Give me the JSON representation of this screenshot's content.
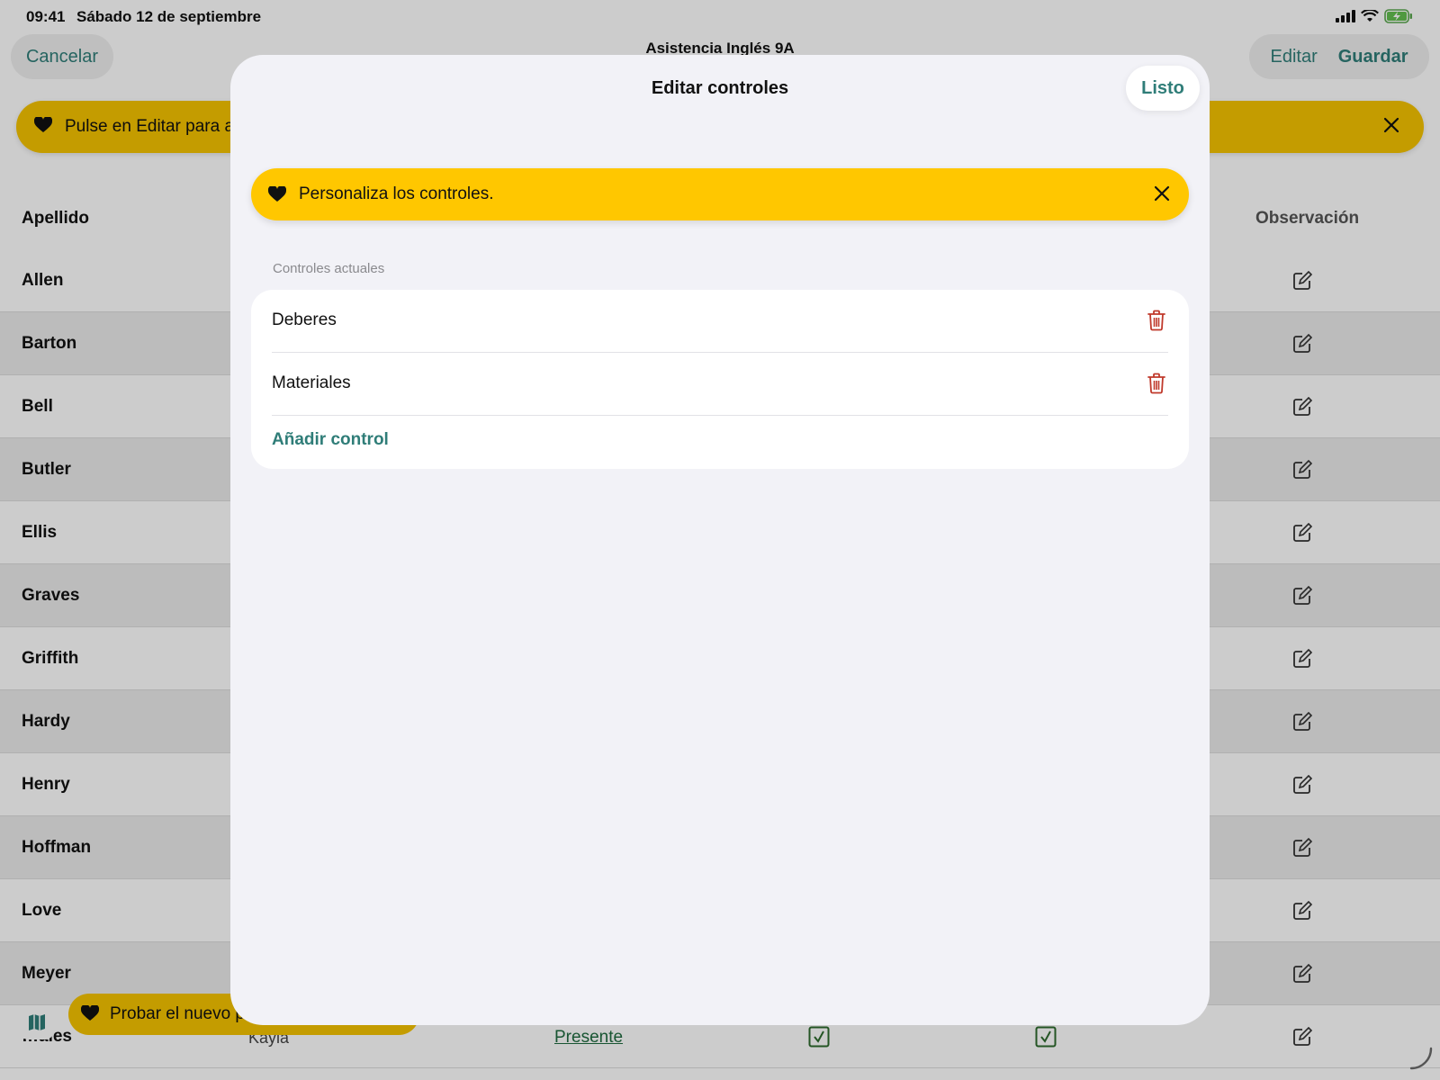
{
  "status_bar": {
    "time": "09:41",
    "date": "Sábado 12 de septiembre"
  },
  "nav": {
    "cancel_label": "Cancelar",
    "title": "Asistencia Inglés 9A",
    "edit_label": "Editar",
    "save_label": "Guardar"
  },
  "background_banner": {
    "text": "Pulse en Editar para a",
    "icon": "heart-icon"
  },
  "table": {
    "column_last_name": "Apellido",
    "column_observation": "Observación",
    "rows": [
      {
        "last_name": "Allen"
      },
      {
        "last_name": "Barton"
      },
      {
        "last_name": "Bell"
      },
      {
        "last_name": "Butler"
      },
      {
        "last_name": "Ellis"
      },
      {
        "last_name": "Graves"
      },
      {
        "last_name": "Griffith"
      },
      {
        "last_name": "Hardy"
      },
      {
        "last_name": "Henry"
      },
      {
        "last_name": "Hoffman"
      },
      {
        "last_name": "Love"
      },
      {
        "last_name": "Meyer"
      },
      {
        "last_name": "…ales",
        "first_name": "Kayla",
        "attendance": "Presente"
      }
    ]
  },
  "bottom_pill": {
    "text": "Probar el nuevo p",
    "icon": "heart-icon"
  },
  "sheet": {
    "title": "Editar controles",
    "done_label": "Listo",
    "tip_text": "Personaliza los controles.",
    "section_header": "Controles actuales",
    "controls": [
      {
        "label": "Deberes"
      },
      {
        "label": "Materiales"
      }
    ],
    "add_label": "Añadir control"
  },
  "colors": {
    "accent": "#2f7d78",
    "banner": "#ffc700",
    "delete": "#c0392b",
    "sheet_bg": "#f2f2f7"
  }
}
